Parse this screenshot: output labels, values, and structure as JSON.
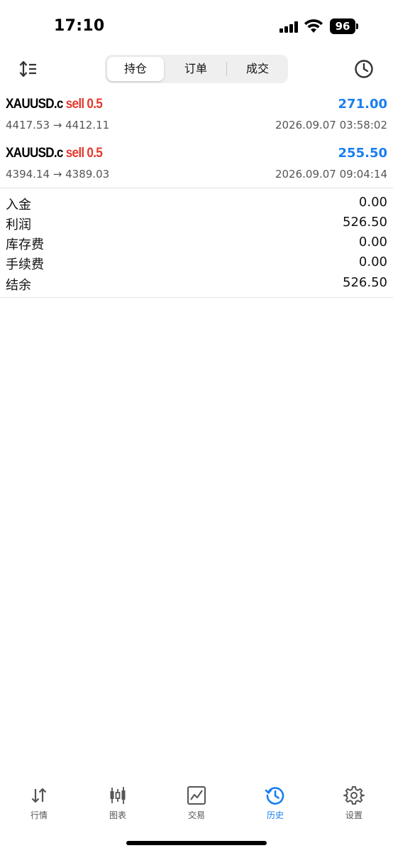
{
  "status_bar": {
    "time": "17:10",
    "battery": "96",
    "icons": [
      "signal-icon",
      "wifi-icon",
      "battery-icon"
    ]
  },
  "top_nav": {
    "left_icon": "sort-icon",
    "right_icon": "clock-icon",
    "tabs": [
      {
        "label": "持仓",
        "active": true
      },
      {
        "label": "订单",
        "active": false
      },
      {
        "label": "成交",
        "active": false
      }
    ]
  },
  "trades": [
    {
      "symbol": "XAUUSD.c",
      "side": "sell 0.5",
      "profit": "271.00",
      "prices": "4417.53 → 4412.11",
      "time": "2026.09.07 03:58:02"
    },
    {
      "symbol": "XAUUSD.c",
      "side": "sell 0.5",
      "profit": "255.50",
      "prices": "4394.14 → 4389.03",
      "time": "2026.09.07 09:04:14"
    }
  ],
  "summary": [
    {
      "label": "入金",
      "value": "0.00"
    },
    {
      "label": "利润",
      "value": "526.50"
    },
    {
      "label": "库存费",
      "value": "0.00"
    },
    {
      "label": "手续费",
      "value": "0.00"
    },
    {
      "label": "结余",
      "value": "526.50"
    }
  ],
  "tab_bar": [
    {
      "label": "行情",
      "icon": "quotes-arrows-icon",
      "active": false
    },
    {
      "label": "图表",
      "icon": "candlestick-chart-icon",
      "active": false
    },
    {
      "label": "交易",
      "icon": "trade-chart-icon",
      "active": false
    },
    {
      "label": "历史",
      "icon": "history-clock-icon",
      "active": true
    },
    {
      "label": "设置",
      "icon": "gear-icon",
      "active": false
    }
  ],
  "colors": {
    "accent": "#1a7ff0",
    "sell": "#e23a2e",
    "segment_bg": "#efeff0"
  }
}
